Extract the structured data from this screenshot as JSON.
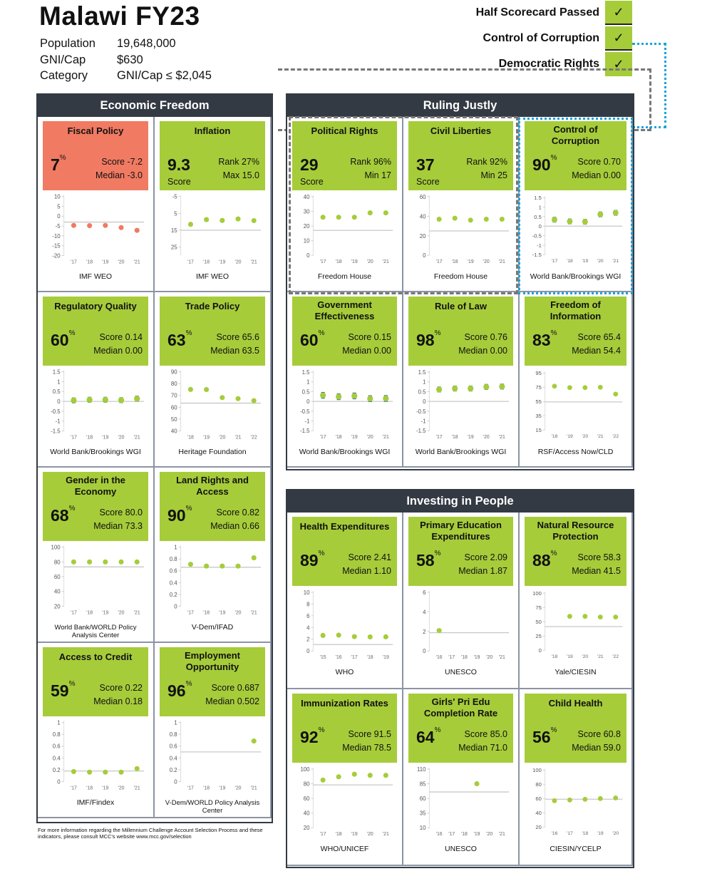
{
  "header": {
    "title": "Malawi FY23",
    "rows": [
      {
        "label": "Population",
        "value": "19,648,000"
      },
      {
        "label": "GNI/Cap",
        "value": "$630"
      },
      {
        "label": "Category",
        "value": "GNI/Cap  ≤  $2,045"
      }
    ]
  },
  "status": [
    {
      "label": "Half Scorecard Passed",
      "mark": "✓"
    },
    {
      "label": "Control of Corruption",
      "mark": "✓"
    },
    {
      "label": "Democratic Rights",
      "mark": "✓"
    }
  ],
  "colors": {
    "pass": "#a6cc3a",
    "fail": "#f07a62",
    "header": "#333a44",
    "ci": "#1f5fa8"
  },
  "footer": "For more information regarding the Millennium Challenge Account Selection Process and these indicators, please consult MCC's website www.mcc.gov/selection",
  "sections": {
    "economic_freedom": "Economic Freedom",
    "ruling_justly": "Ruling Justly",
    "investing_in_people": "Investing in People"
  },
  "chart_data": [
    {
      "id": "ef0",
      "type": "scatter",
      "title": "Fiscal Policy",
      "status": "fail",
      "big": "7",
      "pct": true,
      "r1": "Score -7.2",
      "r2": "Median -3.0",
      "source": "IMF WEO",
      "x": [
        "'17",
        "'18",
        "'19",
        "'20",
        "'21"
      ],
      "values": [
        -4.7,
        -4.8,
        -4.7,
        -5.8,
        -7.2
      ],
      "ref": -3.0,
      "yticks": [
        10,
        5,
        0,
        -5,
        -10,
        -15,
        -20
      ],
      "ylim": [
        -20,
        10
      ]
    },
    {
      "id": "ef1",
      "type": "scatter",
      "title": "Inflation",
      "status": "pass",
      "big": "9.3",
      "pct": false,
      "scoreLabel": "Score",
      "r1": "Rank 27%",
      "r2": "Max 15.0",
      "source": "IMF WEO",
      "x": [
        "'17",
        "'18",
        "'19",
        "'20",
        "'21"
      ],
      "values": [
        11.5,
        8.7,
        9.2,
        8.3,
        9.3
      ],
      "ref": 15.0,
      "yticks": [
        -5,
        5,
        15,
        25
      ],
      "ylim": [
        -5,
        30
      ],
      "inverted": true
    },
    {
      "id": "ef2",
      "type": "scatter",
      "title": "Regulatory Quality",
      "status": "pass",
      "big": "60",
      "pct": true,
      "r1": "Score 0.14",
      "r2": "Median 0.00",
      "source": "World Bank/Brookings WGI",
      "x": [
        "'17",
        "'18",
        "'19",
        "'20",
        "'21"
      ],
      "values": [
        0.05,
        0.08,
        0.08,
        0.06,
        0.14
      ],
      "ci": 0.15,
      "ref": 0,
      "yticks": [
        1.5,
        1,
        0.5,
        0,
        -0.5,
        -1,
        -1.5
      ],
      "ylim": [
        -1.5,
        1.5
      ]
    },
    {
      "id": "ef3",
      "type": "scatter",
      "title": "Trade Policy",
      "status": "pass",
      "big": "63",
      "pct": true,
      "r1": "Score 65.6",
      "r2": "Median 63.5",
      "source": "Heritage Foundation",
      "x": [
        "'18",
        "'19",
        "'20",
        "'21",
        "'22"
      ],
      "values": [
        75.1,
        75.0,
        68.2,
        67.3,
        65.6
      ],
      "ref": 63.5,
      "yticks": [
        90,
        80,
        70,
        60,
        50,
        40
      ],
      "ylim": [
        40,
        90
      ]
    },
    {
      "id": "ef4",
      "type": "scatter",
      "title": "Gender in the Economy",
      "status": "pass",
      "big": "68",
      "pct": true,
      "r1": "Score 80.0",
      "r2": "Median 73.3",
      "source": "World Bank/WORLD Policy Analysis Center",
      "x": [
        "'17",
        "'18",
        "'19",
        "'20",
        "'21"
      ],
      "values": [
        80,
        80,
        80,
        80,
        80
      ],
      "ref": 73.3,
      "yticks": [
        100,
        80,
        60,
        40,
        20
      ],
      "ylim": [
        20,
        100
      ]
    },
    {
      "id": "ef5",
      "type": "scatter",
      "title": "Land Rights and Access",
      "status": "pass",
      "big": "90",
      "pct": true,
      "r1": "Score 0.82",
      "r2": "Median 0.66",
      "source": "V-Dem/IFAD",
      "x": [
        "'17",
        "'18",
        "'19",
        "'20",
        "'21"
      ],
      "values": [
        0.71,
        0.68,
        0.68,
        0.68,
        0.82
      ],
      "ref": 0.66,
      "yticks": [
        1,
        0.8,
        0.6,
        0.4,
        0.2,
        0
      ],
      "ylim": [
        0,
        1
      ]
    },
    {
      "id": "ef6",
      "type": "scatter",
      "title": "Access to Credit",
      "status": "pass",
      "big": "59",
      "pct": true,
      "r1": "Score 0.22",
      "r2": "Median 0.18",
      "source": "IMF/Findex",
      "x": [
        "'17",
        "'18",
        "'19",
        "'20",
        "'21"
      ],
      "values": [
        0.17,
        0.16,
        0.16,
        0.16,
        0.22
      ],
      "ref": 0.18,
      "yticks": [
        1,
        0.8,
        0.6,
        0.4,
        0.2,
        0
      ],
      "ylim": [
        0,
        1
      ]
    },
    {
      "id": "ef7",
      "type": "scatter",
      "title": "Employment Opportunity",
      "status": "pass",
      "big": "96",
      "pct": true,
      "r1": "Score 0.687",
      "r2": "Median 0.502",
      "source": "V-Dem/WORLD Policy Analysis Center",
      "x": [
        "'17",
        "'18",
        "'19",
        "'20",
        "'21"
      ],
      "values": [
        null,
        null,
        null,
        null,
        0.687
      ],
      "ref": 0.502,
      "yticks": [
        1,
        0.8,
        0.6,
        0.4,
        0.2,
        0
      ],
      "ylim": [
        0,
        1
      ]
    },
    {
      "id": "rj0",
      "type": "scatter",
      "title": "Political Rights",
      "status": "pass",
      "big": "29",
      "pct": false,
      "scoreLabel": "Score",
      "r1": "Rank 96%",
      "r2": "Min 17",
      "source": "Freedom House",
      "x": [
        "'17",
        "'18",
        "'19",
        "'20",
        "'21"
      ],
      "values": [
        26,
        26,
        26,
        29,
        29
      ],
      "ref": 17,
      "yticks": [
        40,
        30,
        20,
        10,
        0
      ],
      "ylim": [
        0,
        40
      ]
    },
    {
      "id": "rj1",
      "type": "scatter",
      "title": "Civil Liberties",
      "status": "pass",
      "big": "37",
      "pct": false,
      "scoreLabel": "Score",
      "r1": "Rank 92%",
      "r2": "Min 25",
      "source": "Freedom House",
      "x": [
        "'17",
        "'18",
        "'19",
        "'20",
        "'21"
      ],
      "values": [
        37,
        38,
        36,
        37,
        37
      ],
      "ref": 25,
      "yticks": [
        60,
        40,
        20,
        0
      ],
      "ylim": [
        0,
        60
      ]
    },
    {
      "id": "rj2",
      "type": "scatter",
      "title": "Control of Corruption",
      "status": "pass",
      "big": "90",
      "pct": true,
      "r1": "Score 0.70",
      "r2": "Median 0.00",
      "source": "World Bank/Brookings WGI",
      "x": [
        "'17",
        "'18",
        "'19",
        "'20",
        "'21"
      ],
      "values": [
        0.34,
        0.25,
        0.23,
        0.62,
        0.7
      ],
      "ci": 0.15,
      "ref": 0,
      "yticks": [
        1.5,
        1,
        0.5,
        0,
        -0.5,
        -1,
        -1.5
      ],
      "ylim": [
        -1.5,
        1.5
      ]
    },
    {
      "id": "rj3",
      "type": "scatter",
      "title": "Government Effectiveness",
      "status": "pass",
      "big": "60",
      "pct": true,
      "r1": "Score 0.15",
      "r2": "Median 0.00",
      "source": "World Bank/Brookings WGI",
      "x": [
        "'17",
        "'18",
        "'19",
        "'20",
        "'21"
      ],
      "values": [
        0.31,
        0.24,
        0.28,
        0.14,
        0.15
      ],
      "ci": 0.17,
      "ref": 0,
      "yticks": [
        1.5,
        1,
        0.5,
        0,
        -0.5,
        -1,
        -1.5
      ],
      "ylim": [
        -1.5,
        1.5
      ]
    },
    {
      "id": "rj4",
      "type": "scatter",
      "title": "Rule of Law",
      "status": "pass",
      "big": "98",
      "pct": true,
      "r1": "Score 0.76",
      "r2": "Median 0.00",
      "source": "World Bank/Brookings WGI",
      "x": [
        "'17",
        "'18",
        "'19",
        "'20",
        "'21"
      ],
      "values": [
        0.61,
        0.66,
        0.66,
        0.74,
        0.76
      ],
      "ci": 0.15,
      "ref": 0,
      "yticks": [
        1.5,
        1,
        0.5,
        0,
        -0.5,
        -1,
        -1.5
      ],
      "ylim": [
        -1.5,
        1.5
      ]
    },
    {
      "id": "rj5",
      "type": "scatter",
      "title": "Freedom of Information",
      "status": "pass",
      "big": "83",
      "pct": true,
      "r1": "Score 65.4",
      "r2": "Median 54.4",
      "source": "RSF/Access Now/CLD",
      "x": [
        "'18",
        "'19",
        "'20",
        "'21",
        "'22"
      ],
      "values": [
        76.5,
        74.5,
        74.5,
        75.0,
        65.4
      ],
      "ref": 54.4,
      "yticks": [
        95,
        75,
        55,
        35,
        15
      ],
      "ylim": [
        15,
        95
      ]
    },
    {
      "id": "ip0",
      "type": "scatter",
      "title": "Health Expenditures",
      "status": "pass",
      "big": "89",
      "pct": true,
      "r1": "Score 2.41",
      "r2": "Median 1.10",
      "source": "WHO",
      "x": [
        "'15",
        "'16",
        "'17",
        "'18",
        "'19"
      ],
      "values": [
        2.65,
        2.7,
        2.45,
        2.4,
        2.41
      ],
      "ref": 1.1,
      "yticks": [
        10,
        8,
        6,
        4,
        2,
        0
      ],
      "ylim": [
        0,
        10
      ]
    },
    {
      "id": "ip1",
      "type": "scatter",
      "title": "Primary Education Expenditures",
      "status": "pass",
      "big": "58",
      "pct": true,
      "r1": "Score 2.09",
      "r2": "Median 1.87",
      "source": "UNESCO",
      "x": [
        "'16",
        "'17",
        "'18",
        "'19",
        "'20",
        "'21"
      ],
      "values": [
        2.09,
        null,
        null,
        null,
        null,
        null
      ],
      "ref": 1.87,
      "yticks": [
        6,
        4,
        2,
        0
      ],
      "ylim": [
        0,
        6
      ]
    },
    {
      "id": "ip2",
      "type": "scatter",
      "title": "Natural Resource Protection",
      "status": "pass",
      "big": "88",
      "pct": true,
      "r1": "Score 58.3",
      "r2": "Median 41.5",
      "source": "Yale/CIESIN",
      "x": [
        "'18",
        "'19",
        "'20",
        "'21",
        "'22"
      ],
      "values": [
        null,
        59.5,
        59.5,
        58.3,
        58.3
      ],
      "ref": 41.5,
      "yticks": [
        100,
        75,
        50,
        25,
        0
      ],
      "ylim": [
        0,
        100
      ]
    },
    {
      "id": "ip3",
      "type": "scatter",
      "title": "Immunization Rates",
      "status": "pass",
      "big": "92",
      "pct": true,
      "r1": "Score 91.5",
      "r2": "Median 78.5",
      "source": "WHO/UNICEF",
      "x": [
        "'17",
        "'18",
        "'19",
        "'20",
        "'21"
      ],
      "values": [
        85,
        89.5,
        93,
        91.5,
        91.5
      ],
      "ref": 78.5,
      "yticks": [
        100,
        80,
        60,
        40,
        20
      ],
      "ylim": [
        20,
        100
      ]
    },
    {
      "id": "ip4",
      "type": "scatter",
      "title": "Girls' Pri Edu Completion Rate",
      "status": "pass",
      "big": "64",
      "pct": true,
      "r1": "Score 85.0",
      "r2": "Median 71.0",
      "source": "UNESCO",
      "x": [
        "'16",
        "'17",
        "'18",
        "'19",
        "'20",
        "'21"
      ],
      "values": [
        null,
        null,
        null,
        85.0,
        null,
        null
      ],
      "ref": 71.0,
      "yticks": [
        110,
        85,
        60,
        35,
        10
      ],
      "ylim": [
        10,
        110
      ]
    },
    {
      "id": "ip5",
      "type": "scatter",
      "title": "Child Health",
      "status": "pass",
      "big": "56",
      "pct": true,
      "r1": "Score 60.8",
      "r2": "Median 59.0",
      "source": "CIESIN/YCELP",
      "x": [
        "'16",
        "'17",
        "'18",
        "'19",
        "'20"
      ],
      "values": [
        57,
        58,
        59,
        60,
        60.8
      ],
      "ref": 59.0,
      "yticks": [
        100,
        80,
        60,
        40,
        20
      ],
      "ylim": [
        20,
        100
      ]
    }
  ]
}
